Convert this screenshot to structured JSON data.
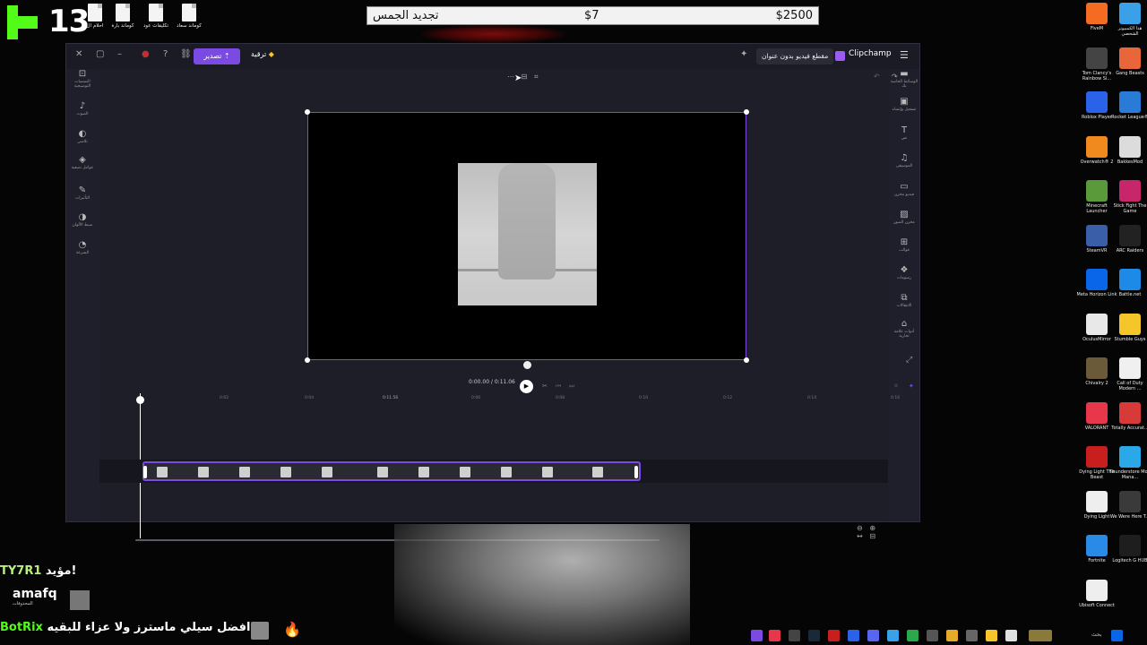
{
  "overlay": {
    "kick_count": "13",
    "top_icons": [
      "احلام ال",
      "كوماند بارة",
      "تكليفات عود",
      "كوماند سعاد"
    ],
    "goal": {
      "title": "تجديد الجمس",
      "current": "$7",
      "target": "$2500"
    }
  },
  "window": {
    "export_label": "تصدير",
    "upgrade_label": "ترقية",
    "project_name": "مقطع فيديو بدون عنوان",
    "brand": "Clipchamp"
  },
  "left_sidebar": [
    {
      "icon": "captions-icon",
      "label": "التسميات التوضيحية"
    },
    {
      "icon": "audio-icon",
      "label": "الصوت"
    },
    {
      "icon": "fade-icon",
      "label": "تلاشي"
    },
    {
      "icon": "filters-icon",
      "label": "عوامل تصفية"
    },
    {
      "icon": "effects-icon",
      "label": "التأثيرات"
    },
    {
      "icon": "color-icon",
      "label": "ضبط الألوان"
    },
    {
      "icon": "speed-icon",
      "label": "السرعة"
    }
  ],
  "right_sidebar": [
    {
      "icon": "media-icon",
      "label": "الوسائط الخاصة بك"
    },
    {
      "icon": "record-icon",
      "label": "تسجيل وإنشاء"
    },
    {
      "icon": "text-icon",
      "label": "نص"
    },
    {
      "icon": "music-icon",
      "label": "الموسيقى"
    },
    {
      "icon": "stock-video-icon",
      "label": "فيديو مخزن"
    },
    {
      "icon": "stock-images-icon",
      "label": "مخزن الصور"
    },
    {
      "icon": "templates-icon",
      "label": "قوالب"
    },
    {
      "icon": "graphics-icon",
      "label": "رسومات"
    },
    {
      "icon": "transitions-icon",
      "label": "الانتقالات"
    },
    {
      "icon": "brand-kit-icon",
      "label": "أدوات علامة تجارية"
    }
  ],
  "player": {
    "current_time": "0:00.00",
    "total_time": "0:11.06",
    "playhead_marker": "0:11.56"
  },
  "ruler_ticks": [
    "0:02",
    "0:04",
    "0:06",
    "0:08",
    "0:10",
    "0:12",
    "0:14",
    "0:16",
    "0:18"
  ],
  "desktop_icons": [
    {
      "label": "FiveM",
      "color": "#f36c21"
    },
    {
      "label": "هذا الكمبيوتر الشخصي",
      "color": "#3aa0e8"
    },
    {
      "label": "Tom Clancy's Rainbow Si...",
      "color": "#444"
    },
    {
      "label": "Gang Beasts",
      "color": "#e8663a"
    },
    {
      "label": "Roblox Player",
      "color": "#2a63e8"
    },
    {
      "label": "Rocket League®",
      "color": "#2a7ad8"
    },
    {
      "label": "Overwatch® 2",
      "color": "#f08a1e"
    },
    {
      "label": "BakkesMod",
      "color": "#dcdcdc"
    },
    {
      "label": "Minecraft Launcher",
      "color": "#5b9a3a"
    },
    {
      "label": "Stick Fight The Game",
      "color": "#c8266a"
    },
    {
      "label": "SteamVR",
      "color": "#3b5ea8"
    },
    {
      "label": "ARC Raiders",
      "color": "#222"
    },
    {
      "label": "Meta Horizon Link",
      "color": "#0a66e8"
    },
    {
      "label": "Battle.net",
      "color": "#1e8ae8"
    },
    {
      "label": "OculusMirror",
      "color": "#e8e8e8"
    },
    {
      "label": "Stumble Guys",
      "color": "#f5c62a"
    },
    {
      "label": "Chivalry 2",
      "color": "#6a5a3a"
    },
    {
      "label": "Call of Duty Modern ...",
      "color": "#f0f0f0"
    },
    {
      "label": "VALORANT",
      "color": "#e8364a"
    },
    {
      "label": "Totally Accurat...",
      "color": "#d83a3a"
    },
    {
      "label": "Dying Light The Beast",
      "color": "#c81e1e"
    },
    {
      "label": "Thunderstore Mod Mana...",
      "color": "#2aa8e8"
    },
    {
      "label": "Dying Light",
      "color": "#eee"
    },
    {
      "label": "We Were Here T...",
      "color": "#3a3a3a"
    },
    {
      "label": "Fortnite",
      "color": "#2a8ae8"
    },
    {
      "label": "Logitech G HUB",
      "color": "#1e1e1e"
    },
    {
      "label": "Ubisoft Connect",
      "color": "#eee"
    }
  ],
  "chat": {
    "sub_text": "مؤيد!",
    "sub_name": "TY7R1",
    "user": "amafq",
    "user_label": "المحذوفات",
    "ticker_bot": "BotRix",
    "ticker_text": "افضل سيلي ماسترز ولا عزاء للبقيه"
  },
  "taskbar": {
    "search_label": "بحث"
  }
}
